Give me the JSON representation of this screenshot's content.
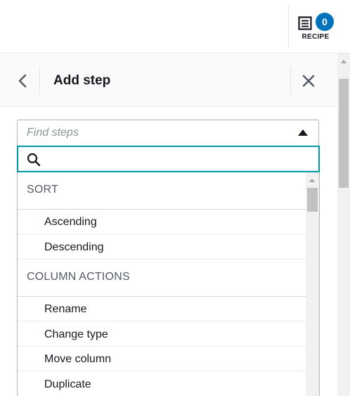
{
  "topbar": {
    "recipe": {
      "count": "0",
      "label": "RECIPE",
      "icon": "recipe-list-icon"
    }
  },
  "panel": {
    "title": "Add step",
    "back_icon": "chevron-left-icon",
    "close_icon": "close-icon"
  },
  "select": {
    "placeholder": "Find steps",
    "caret_icon": "caret-up-icon",
    "search_value": "",
    "search_icon": "search-icon"
  },
  "groups": [
    {
      "label": "SORT",
      "options": [
        "Ascending",
        "Descending"
      ]
    },
    {
      "label": "COLUMN ACTIONS",
      "options": [
        "Rename",
        "Change type",
        "Move column",
        "Duplicate"
      ]
    }
  ],
  "colors": {
    "accent": "#0073bb",
    "focus": "#0097a7"
  }
}
